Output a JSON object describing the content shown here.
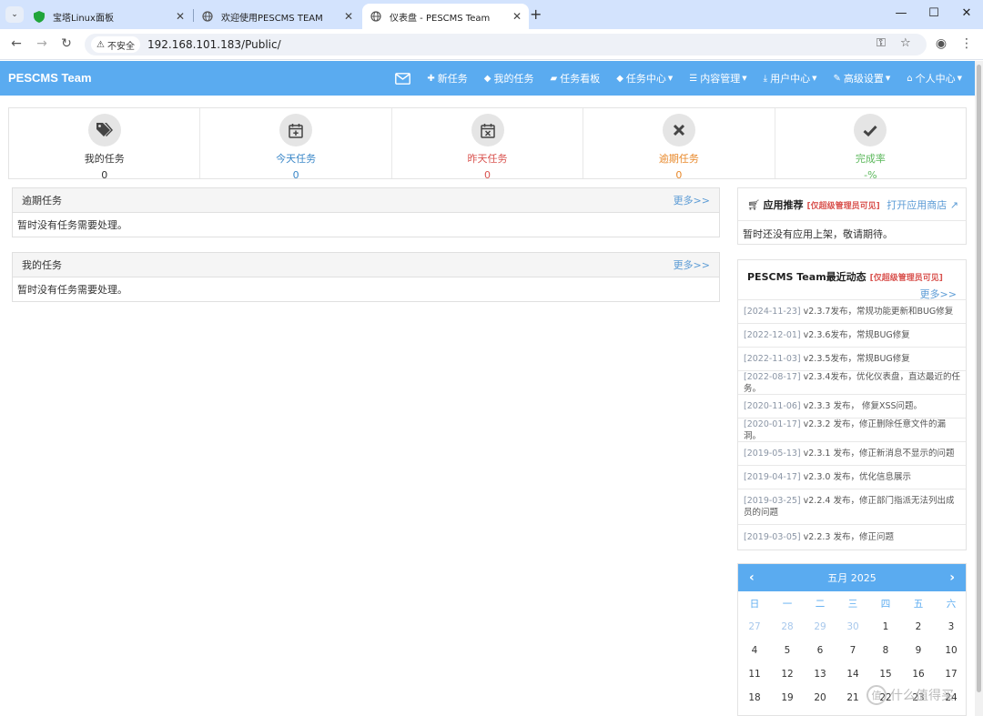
{
  "browser": {
    "tabs": [
      {
        "title": "宝塔Linux面板",
        "active": false
      },
      {
        "title": "欢迎使用PESCMS TEAM",
        "active": false
      },
      {
        "title": "仪表盘 - PESCMS Team",
        "active": true
      }
    ],
    "security_label": "不安全",
    "url": "192.168.101.183/Public/"
  },
  "app": {
    "brand": "PESCMS Team",
    "menu": [
      {
        "label": "新任务",
        "icon": "plus-icon",
        "dropdown": false
      },
      {
        "label": "我的任务",
        "icon": "tag-icon",
        "dropdown": false
      },
      {
        "label": "任务看板",
        "icon": "book-icon",
        "dropdown": false
      },
      {
        "label": "任务中心",
        "icon": "tags-icon",
        "dropdown": true
      },
      {
        "label": "内容管理",
        "icon": "list-icon",
        "dropdown": true
      },
      {
        "label": "用户中心",
        "icon": "download-icon",
        "dropdown": true
      },
      {
        "label": "高级设置",
        "icon": "wrench-icon",
        "dropdown": true
      },
      {
        "label": "个人中心",
        "icon": "home-icon",
        "dropdown": true
      }
    ]
  },
  "stats": [
    {
      "label": "我的任务",
      "value": "0",
      "color": "#333333",
      "icon": "tags-icon"
    },
    {
      "label": "今天任务",
      "value": "0",
      "color": "#3a87c8",
      "icon": "calendar-plus-icon"
    },
    {
      "label": "昨天任务",
      "value": "0",
      "color": "#d9534f",
      "icon": "calendar-times-icon"
    },
    {
      "label": "逾期任务",
      "value": "0",
      "color": "#e8892b",
      "icon": "times-icon"
    },
    {
      "label": "完成率",
      "value": "-%",
      "color": "#5cb85c",
      "icon": "check-icon"
    }
  ],
  "overdue_panel": {
    "title": "逾期任务",
    "more": "更多>>",
    "empty": "暂时没有任务需要处理。"
  },
  "mytask_panel": {
    "title": "我的任务",
    "more": "更多>>",
    "empty": "暂时没有任务需要处理。"
  },
  "app_recommend": {
    "title": "应用推荐",
    "tag": "[仅超级管理员可见]",
    "open_store": "打开应用商店",
    "empty": "暂时还没有应用上架，敬请期待。"
  },
  "news": {
    "title": "PESCMS Team最近动态",
    "tag": "[仅超级管理员可见]",
    "more": "更多>>",
    "items": [
      {
        "date": "[2024-11-23]",
        "text": " v2.3.7发布，常规功能更新和BUG修复"
      },
      {
        "date": "[2022-12-01]",
        "text": " v2.3.6发布，常规BUG修复"
      },
      {
        "date": "[2022-11-03]",
        "text": " v2.3.5发布，常规BUG修复"
      },
      {
        "date": "[2022-08-17]",
        "text": " v2.3.4发布，优化仪表盘，直达最近的任务。"
      },
      {
        "date": "[2020-11-06]",
        "text": " v2.3.3 发布， 修复XSS问题。"
      },
      {
        "date": "[2020-01-17]",
        "text": " v2.3.2 发布，修正删除任意文件的漏洞。"
      },
      {
        "date": "[2019-05-13]",
        "text": " v2.3.1 发布，修正新消息不显示的问题"
      },
      {
        "date": "[2019-04-17]",
        "text": " v2.3.0 发布，优化信息展示"
      },
      {
        "date": "[2019-03-25]",
        "text": " v2.2.4 发布，修正部门指派无法列出成员的问题"
      },
      {
        "date": "[2019-03-05]",
        "text": " v2.2.3 发布，修正问题"
      }
    ]
  },
  "calendar": {
    "title": "五月 2025",
    "weekdays": [
      "日",
      "一",
      "二",
      "三",
      "四",
      "五",
      "六"
    ],
    "weeks": [
      [
        "27",
        "28",
        "29",
        "30",
        "1",
        "2",
        "3"
      ],
      [
        "4",
        "5",
        "6",
        "7",
        "8",
        "9",
        "10"
      ],
      [
        "11",
        "12",
        "13",
        "14",
        "15",
        "16",
        "17"
      ],
      [
        "18",
        "19",
        "20",
        "21",
        "22",
        "23",
        "24"
      ]
    ],
    "prev_month_count": 4
  },
  "watermark": {
    "symbol": "值",
    "text": "什么值得买"
  }
}
